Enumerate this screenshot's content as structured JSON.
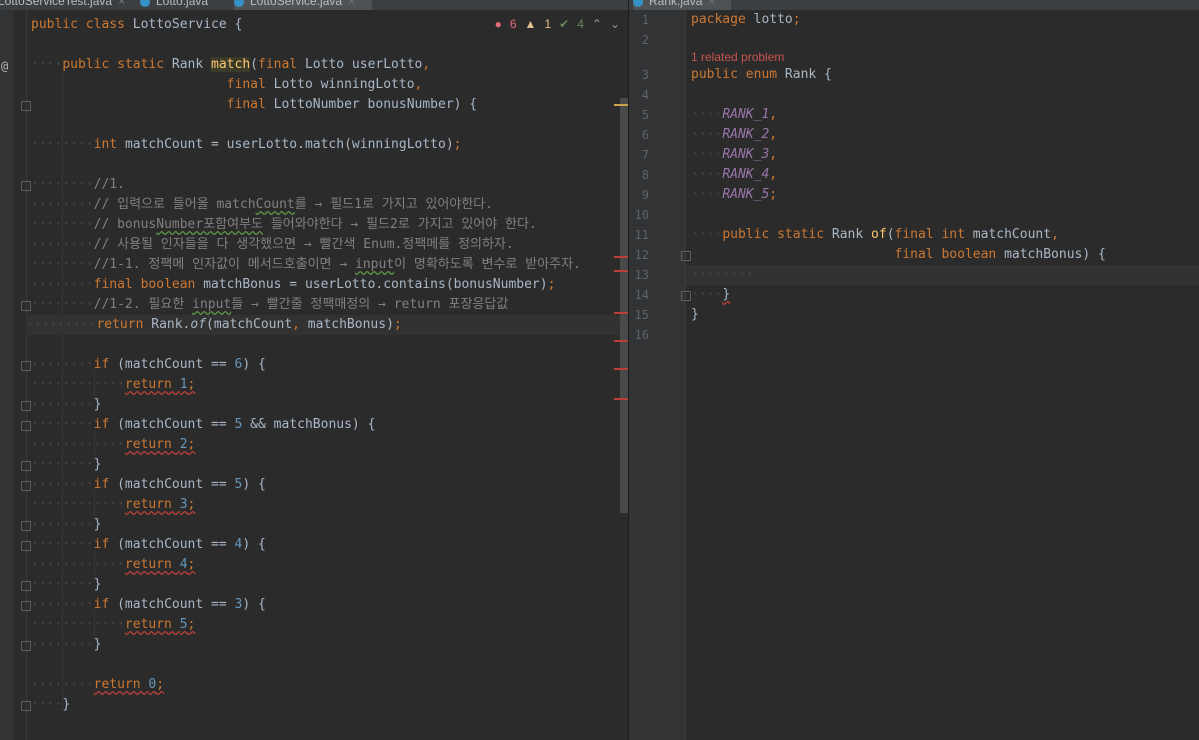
{
  "tabs": [
    {
      "label": "LottoServiceTest.java",
      "active": false
    },
    {
      "label": "Lotto.java",
      "active": false
    },
    {
      "label": "LottoService.java",
      "active": true
    },
    {
      "label": "Rank.java",
      "active": true
    }
  ],
  "left_editor": {
    "file": "LottoService.java",
    "indicators": {
      "errors": "6",
      "warnings": "1",
      "ok": "4",
      "error_icon": "error-circle-icon",
      "warning_icon": "warning-triangle-icon",
      "ok_icon": "checkmark-icon"
    },
    "override_marker": "@",
    "lines": [
      "public class LottoService {",
      "",
      "    public static Rank match(final Lotto userLotto,",
      "                             final Lotto winningLotto,",
      "                             final LottoNumber bonusNumber) {",
      "",
      "        int matchCount = userLotto.match(winningLotto);",
      "",
      "        //1.",
      "        // 입력으로 들어올 matchCount를 → 필드1로 가지고 있어야한다.",
      "        // bonusNumber포함여부도 들어와야한다 → 필드2로 가지고 있어야 한다.",
      "        // 사용될 인자들을 다 생각했으면 → 빨간색 Enum.정팩메를 정의하자.",
      "        //1-1. 정팩메 인자값이 메서드호출이면 → input이 명확하도록 변수로 받아주자.",
      "        final boolean matchBonus = userLotto.contains(bonusNumber);",
      "        //1-2. 필요한 input들 → 빨간줄 정팩매정의 → return 포장응답값",
      "        return Rank.of(matchCount, matchBonus);",
      "",
      "        if (matchCount == 6) {",
      "            return 1;",
      "        }",
      "        if (matchCount == 5 && matchBonus) {",
      "            return 2;",
      "        }",
      "        if (matchCount == 5) {",
      "            return 3;",
      "        }",
      "        if (matchCount == 4) {",
      "            return 4;",
      "        }",
      "        if (matchCount == 3) {",
      "            return 5;",
      "        }",
      "",
      "        return 0;",
      "    }"
    ]
  },
  "right_editor": {
    "file": "Rank.java",
    "related_problem": "1 related problem",
    "line_numbers": [
      "1",
      "2",
      "3",
      "4",
      "5",
      "6",
      "7",
      "8",
      "9",
      "10",
      "11",
      "12",
      "13",
      "14",
      "15",
      "16"
    ],
    "lines": [
      "package lotto;",
      "",
      "public enum Rank {",
      "",
      "    RANK_1,",
      "    RANK_2,",
      "    RANK_3,",
      "    RANK_4,",
      "    RANK_5;",
      "",
      "    public static Rank of(final int matchCount,",
      "                          final boolean matchBonus) {",
      "        ",
      "    }",
      "}",
      ""
    ]
  },
  "colors": {
    "background": "#2b2b2b",
    "keyword": "#cc7832",
    "method": "#ffc66d",
    "number": "#6897bb",
    "comment": "#808080",
    "constant": "#9876aa",
    "error": "#bc3f3c"
  }
}
